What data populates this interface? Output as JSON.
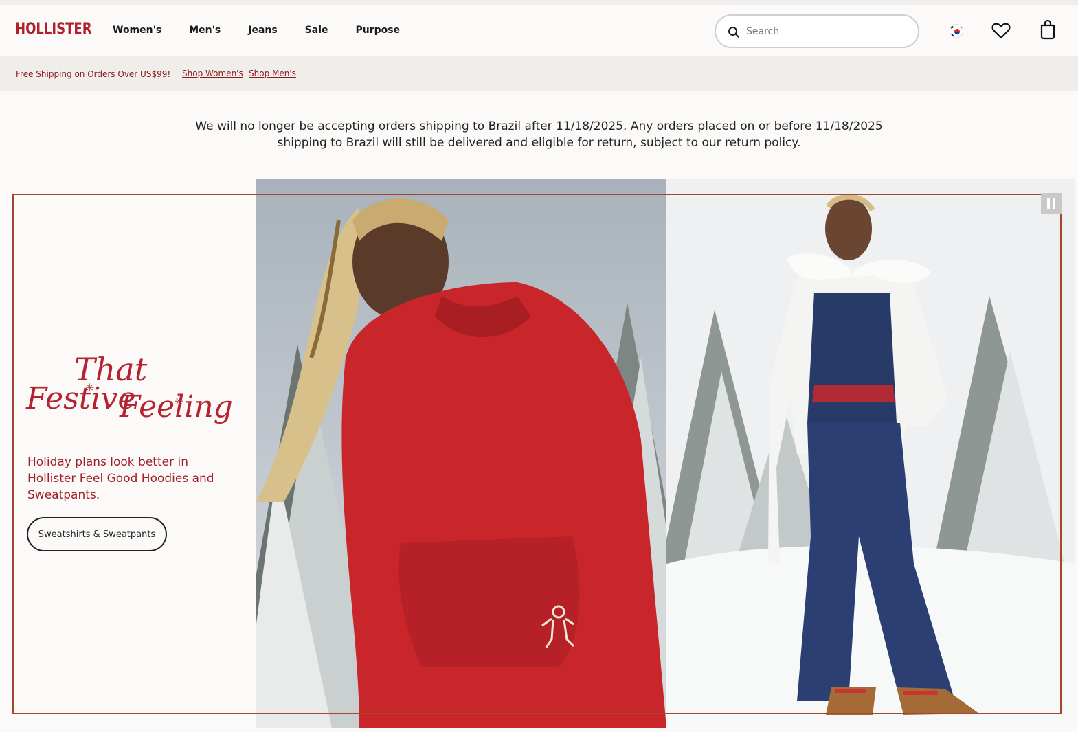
{
  "brand": {
    "logo_text": "HOLLISTER",
    "accent": "#b11f2c"
  },
  "nav": {
    "items": [
      "Women's",
      "Men's",
      "Jeans",
      "Sale",
      "Purpose"
    ]
  },
  "search": {
    "placeholder": "Search",
    "icon": "search-icon"
  },
  "header_icons": {
    "flag": "south-korea-flag-icon",
    "wishlist": "heart-icon",
    "bag": "shopping-bag-icon"
  },
  "promo": {
    "shipping": "Free Shipping on Orders Over US$99!",
    "link_women": "Shop Women's",
    "link_men": "Shop Men's"
  },
  "notice": {
    "line1": "We will no longer be accepting orders shipping to Brazil after 11/18/2025. Any orders placed on or before 11/18/2025",
    "line2": "shipping to Brazil will still be delivered and eligible for return, subject to our return policy."
  },
  "hero": {
    "headline_1": "That",
    "headline_2": "Festive",
    "headline_3": "Feeling",
    "description": "Holiday plans look better in Hollister Feel Good Hoodies and Sweatpants.",
    "button": "Sweatshirts & Sweatpants",
    "pause_icon": "pause-icon"
  }
}
